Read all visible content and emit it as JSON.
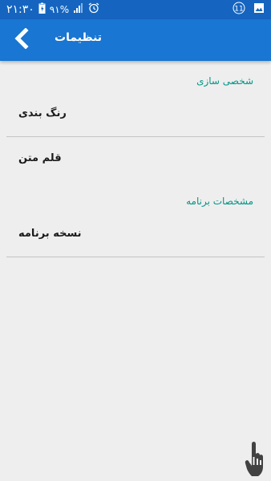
{
  "status_bar": {
    "time": "۲۱:۳۰",
    "battery": "۹۱%",
    "notification_count": "11"
  },
  "app_bar": {
    "title": "تنظیمات"
  },
  "sections": [
    {
      "title": "شخصی سازی",
      "items": [
        {
          "label": "رنگ بندی"
        },
        {
          "label": "قلم متن"
        }
      ]
    },
    {
      "title": "مشخصات برنامه",
      "items": [
        {
          "label": "نسخه برنامه"
        }
      ]
    }
  ],
  "colors": {
    "status_bar": "#1565c0",
    "app_bar": "#1976d2",
    "section_header": "#009688",
    "background": "#eeeeee",
    "divider": "#c4c4c4"
  },
  "icons": {
    "back": "chevron-left-icon",
    "alarm": "alarm-clock-icon",
    "signal": "signal-icon",
    "battery": "battery-charging-icon",
    "notification": "notification-count-icon",
    "image": "image-icon",
    "hand": "hand-swipe-icon"
  }
}
